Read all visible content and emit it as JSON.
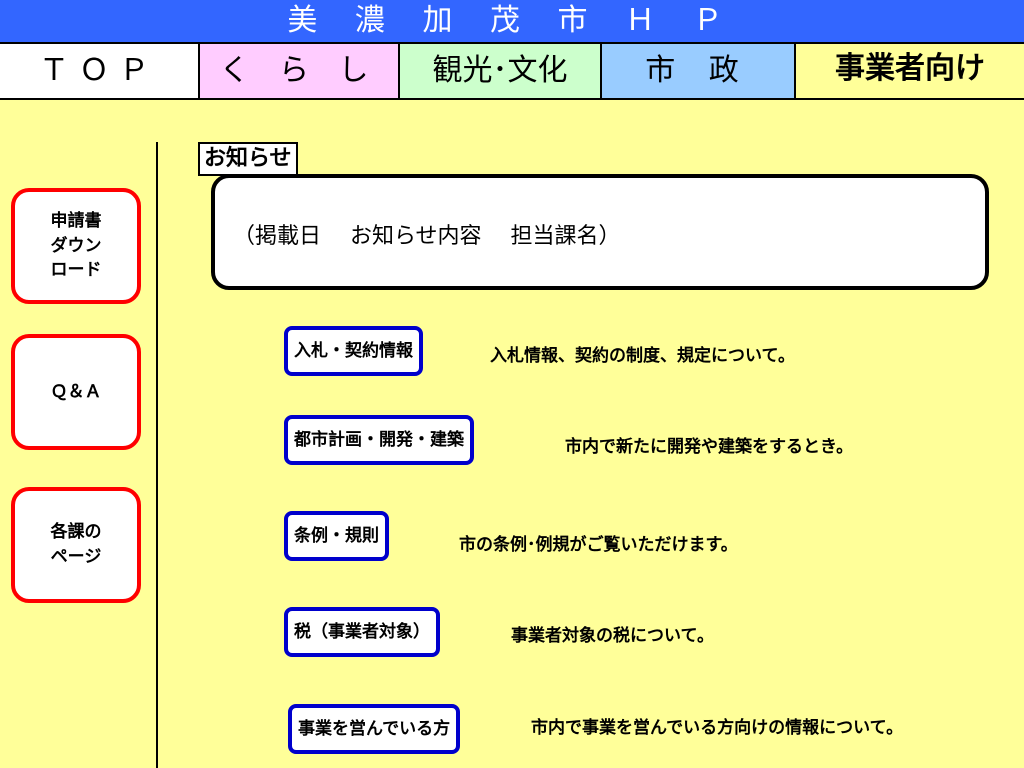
{
  "header": {
    "title": "美 濃 加 茂 市 Ｈ Ｐ"
  },
  "nav": {
    "top": "ＴＯＰ",
    "kurashi": "く ら し",
    "kanko": "観光･文化",
    "shisei": "市 政",
    "jigyo": "事業者向け"
  },
  "sidebar": {
    "items": [
      {
        "label": "申請書\nダウン\nロード"
      },
      {
        "label": "Ｑ＆Ａ"
      },
      {
        "label": "各課の\nページ"
      }
    ]
  },
  "notice": {
    "label": "お知らせ",
    "content": "（掲載日　 お知らせ内容　 担当課名）"
  },
  "categories": [
    {
      "label": "入札・契約情報",
      "description": "入札情報、契約の制度、規定について。"
    },
    {
      "label": "都市計画・開発・建築",
      "description": "市内で新たに開発や建築をするとき。"
    },
    {
      "label": "条例・規則",
      "description": "市の条例･例規がご覧いただけます。"
    },
    {
      "label": "税（事業者対象）",
      "description": "事業者対象の税について。"
    },
    {
      "label": "事業を営んでいる方",
      "description": "市内で事業を営んでいる方向けの情報について。"
    }
  ],
  "colors": {
    "background": "#ffff99",
    "title_bar": "#3366ff",
    "kurashi": "#ffccff",
    "kanko": "#ccffcc",
    "shisei": "#99ccff",
    "side_border": "#ff0000",
    "category_border": "#0000cc"
  }
}
